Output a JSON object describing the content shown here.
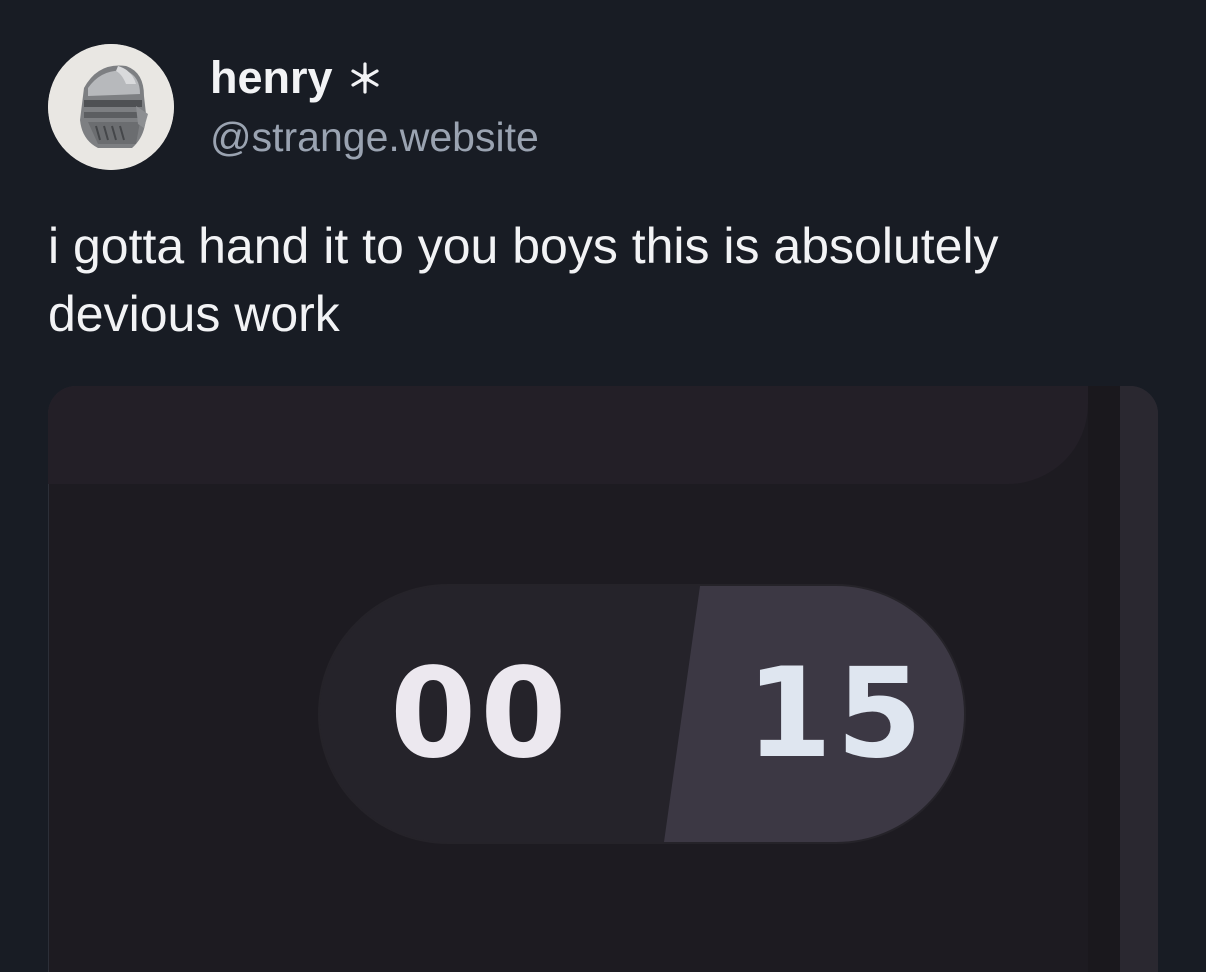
{
  "author": {
    "display_name": "henry",
    "badge_icon": "asterisk-star-icon",
    "handle": "@strange.website",
    "avatar_icon": "knight-helmet-icon"
  },
  "post": {
    "text": "i gotta hand it to you boys this is absolutely devious work"
  },
  "media": {
    "timer_left": "00",
    "timer_right": "15"
  },
  "colors": {
    "background": "#181c24",
    "text": "#f2f3f5",
    "handle": "#9aa3b1",
    "media_bg": "#1d1b21",
    "timer_pill": "#2b2930"
  }
}
